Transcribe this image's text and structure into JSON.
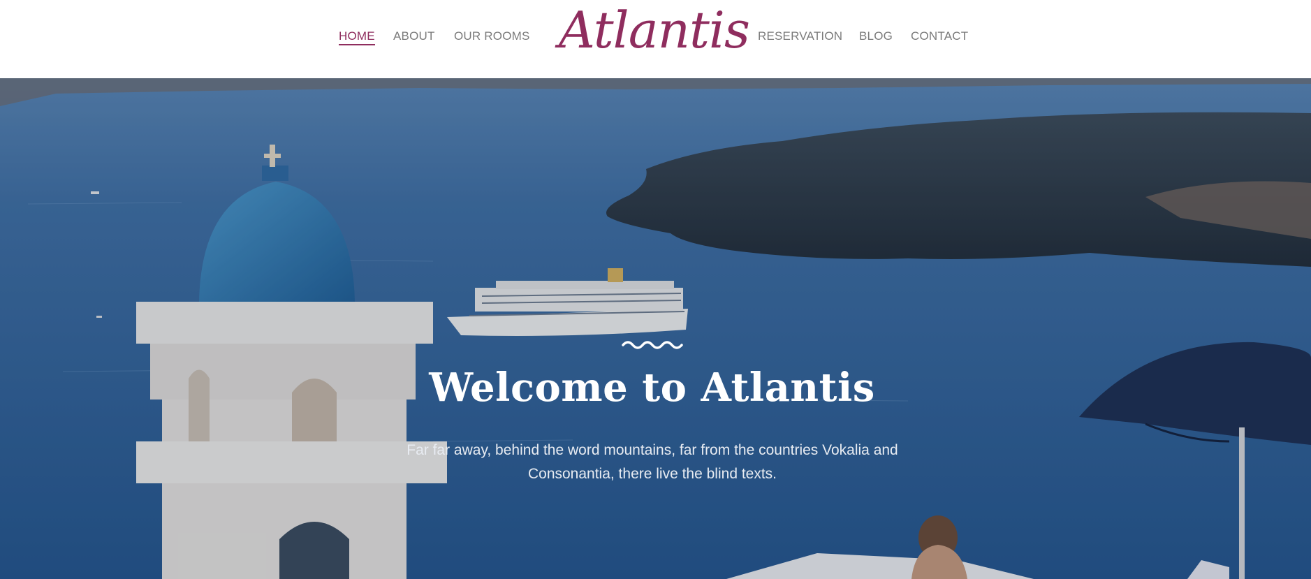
{
  "nav": {
    "left": [
      {
        "label": "HOME",
        "active": true
      },
      {
        "label": "ABOUT"
      },
      {
        "label": "OUR ROOMS"
      }
    ],
    "right": [
      {
        "label": "RESERVATION"
      },
      {
        "label": "BLOG"
      },
      {
        "label": "CONTACT"
      }
    ]
  },
  "logo": {
    "text": "Atlantis"
  },
  "hero": {
    "title": "Welcome to Atlantis",
    "text": "Far far away, behind the word mountains, far from the countries Vokalia and Consonantia, there live the blind texts.",
    "ornament_icon": "wave-icon"
  },
  "colors": {
    "brand": "#8f2d5e",
    "nav_text": "#7b7b7b",
    "sea": "#2f5f93"
  }
}
